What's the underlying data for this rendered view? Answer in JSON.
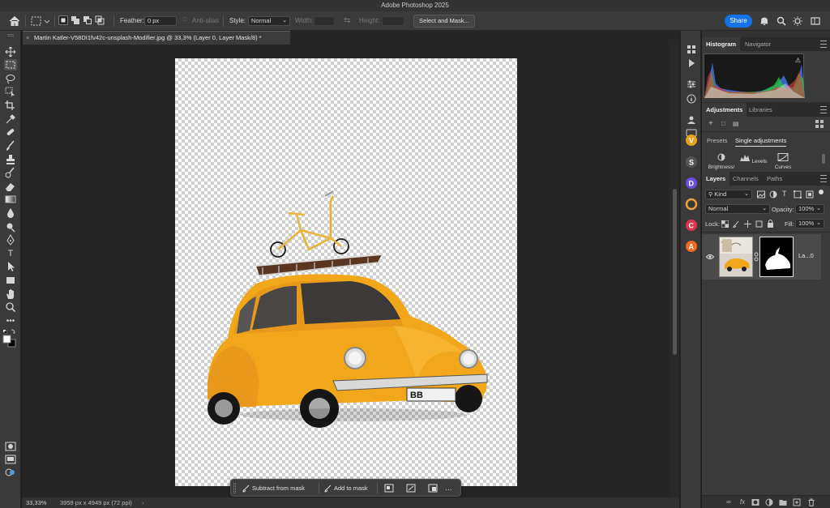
{
  "app": {
    "title": "Adobe Photoshop 2025"
  },
  "options_bar": {
    "feather_label": "Feather:",
    "feather_value": "0 px",
    "anti_alias_label": "Anti-alias",
    "style_label": "Style:",
    "style_value": "Normal",
    "width_label": "Width:",
    "height_label": "Height:",
    "select_and_mask": "Select and Mask...",
    "share": "Share"
  },
  "document": {
    "tab_title": "Martin Katler-V58DI1fv42c-unsplash-Modifier.jpg @ 33,3% (Layer 0, Layer Mask/8) *",
    "plate_text": "BB"
  },
  "taskbar": {
    "subtract": "Subtract from mask",
    "add": "Add to mask",
    "more": "…"
  },
  "status": {
    "zoom": "33,33%",
    "dimensions": "3959 px x 4949 px (72 ppi)",
    "arrow": "›"
  },
  "panels": {
    "histogram_tab": "Histogram",
    "navigator_tab": "Navigator",
    "adjustments_tab": "Adjustments",
    "libraries_tab": "Libraries",
    "presets": "Presets",
    "single_adjustments": "Single adjustments",
    "brightness": "Brightness/",
    "levels": "Levels",
    "curves": "Curves",
    "layers_tab": "Layers",
    "channels_tab": "Channels",
    "paths_tab": "Paths",
    "kind": "Kind",
    "blend_mode": "Normal",
    "opacity_label": "Opacity:",
    "opacity_value": "100%",
    "lock_label": "Lock:",
    "fill_label": "Fill:",
    "fill_value": "100%",
    "layer_name": "La...0"
  },
  "colors": {
    "accent": "#1473e6",
    "car_yellow": "#f2a71b",
    "panel_bg": "#3a3a3a",
    "workspace_bg": "#262626"
  }
}
